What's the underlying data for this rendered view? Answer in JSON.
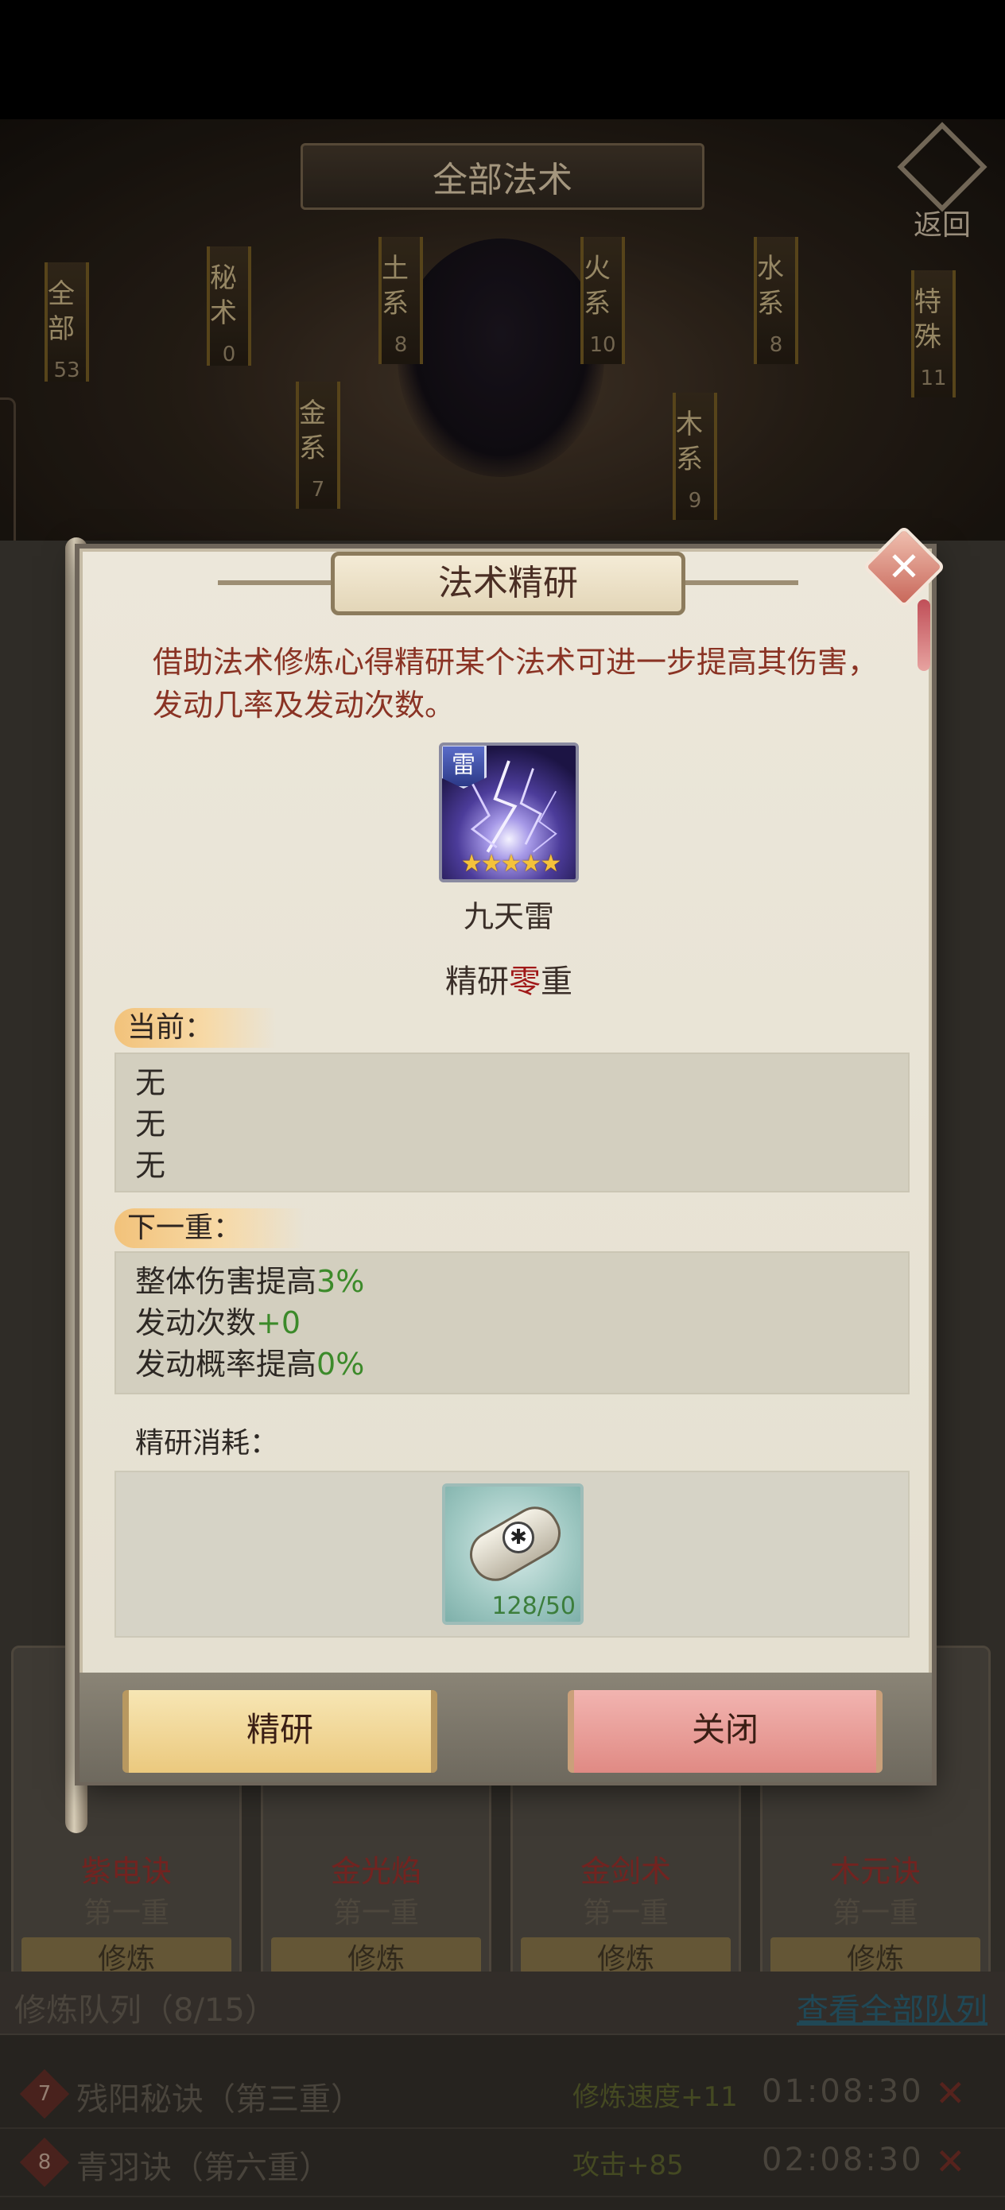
{
  "top_screen": {
    "title": "全部法术",
    "back_label": "返回",
    "schools": [
      {
        "label": "全部",
        "count": "53"
      },
      {
        "label": "秘术",
        "count": "0"
      },
      {
        "label": "土系",
        "count": "8"
      },
      {
        "label": "金系",
        "count": "7"
      },
      {
        "label": "火系",
        "count": "10"
      },
      {
        "label": "木系",
        "count": "9"
      },
      {
        "label": "水系",
        "count": "8"
      },
      {
        "label": "特殊",
        "count": "11"
      }
    ]
  },
  "spell_cards": [
    {
      "name": "紫电诀",
      "level": "第一重",
      "button": "修炼"
    },
    {
      "name": "金光焰",
      "level": "第一重",
      "button": "修炼"
    },
    {
      "name": "金剑术",
      "level": "第一重",
      "button": "修炼"
    },
    {
      "name": "木元诀",
      "level": "第一重",
      "button": "修炼"
    }
  ],
  "queue": {
    "title": "修炼队列（8/15）",
    "view_all": "查看全部队列",
    "rows": [
      {
        "index": "7",
        "name": "残阳秘诀（第三重）",
        "effect": "修炼速度+11",
        "time": "01:08:30"
      },
      {
        "index": "8",
        "name": "青羽诀（第六重）",
        "effect": "攻击+85",
        "time": "02:08:30"
      }
    ]
  },
  "dialog": {
    "title": "法术精研",
    "description": "借助法术修炼心得精研某个法术可进一步提高其伤害，发动几率及发动次数。",
    "spell": {
      "element": "雷",
      "name": "九天雷",
      "stars": "★★★★★",
      "refine_prefix": "精研",
      "refine_level": "零",
      "refine_suffix": "重"
    },
    "current": {
      "label": "当前：",
      "lines": [
        "无",
        "无",
        "无"
      ]
    },
    "next": {
      "label": "下一重：",
      "lines": [
        {
          "text": "整体伤害提高",
          "value": "3%"
        },
        {
          "text": "发动次数",
          "value": "+0"
        },
        {
          "text": "发动概率提高",
          "value": "0%"
        }
      ]
    },
    "cost": {
      "label": "精研消耗：",
      "item_count": "128/50"
    },
    "buttons": {
      "refine": "精研",
      "close": "关闭"
    },
    "colors": {
      "description": "#8a3324",
      "value_green": "#3c8a2a",
      "level_red": "#a01818"
    }
  }
}
